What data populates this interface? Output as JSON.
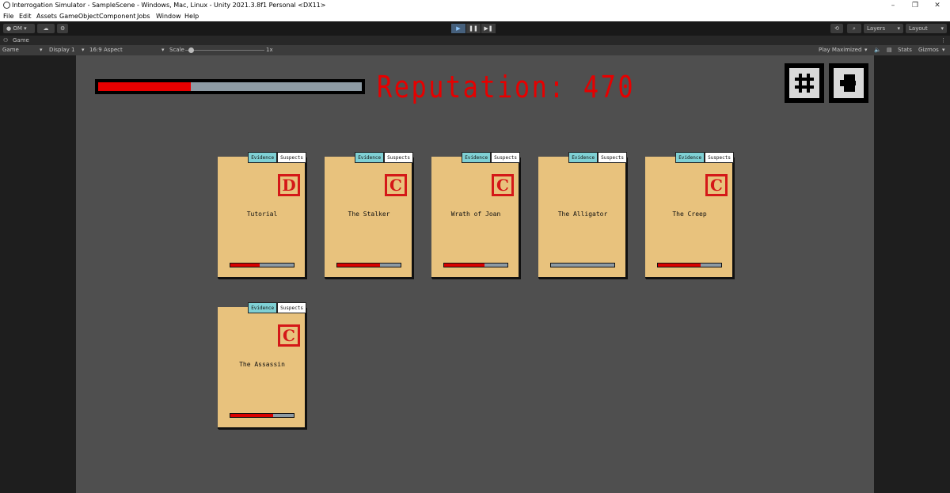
{
  "window": {
    "title": "Interrogation Simulator - SampleScene - Windows, Mac, Linux - Unity 2021.3.8f1 Personal <DX11>",
    "minimize": "–",
    "restore": "❐",
    "close": "✕"
  },
  "menu": [
    "File",
    "Edit",
    "Assets",
    "GameObject",
    "Component",
    "Jobs",
    "Window",
    "Help"
  ],
  "toolbar": {
    "account": "OM ▾",
    "layers": "Layers",
    "layout": "Layout",
    "play": "▶",
    "pause": "❚❚",
    "step": "▶❚"
  },
  "game_tab": {
    "label": "Game",
    "view_select": "Game",
    "display": "Display 1",
    "aspect": "16:9 Aspect",
    "scale_label": "Scale",
    "scale_value": "1x",
    "play_mode": "Play Maximized",
    "stats": "Stats",
    "gizmos": "Gizmos"
  },
  "hud": {
    "reputation_text": "Reputation: 470",
    "reputation_fraction": 0.35,
    "grid_button_icon": "hash-icon",
    "exit_button_icon": "door-exit-icon"
  },
  "colors": {
    "accent_red": "#e60000",
    "card_tan": "#e8c27d",
    "evidence_tab": "#7fd0d4"
  },
  "cases": [
    {
      "name": "Tutorial",
      "grade": "D",
      "progress": 0.46,
      "evidence_tab": "Evidence",
      "suspects_tab": "Suspects"
    },
    {
      "name": "The Stalker",
      "grade": "C",
      "progress": 0.67,
      "evidence_tab": "Evidence",
      "suspects_tab": "Suspects"
    },
    {
      "name": "Wrath of Joan",
      "grade": "C",
      "progress": 0.64,
      "evidence_tab": "Evidence",
      "suspects_tab": "Suspects"
    },
    {
      "name": "The Alligator",
      "grade": "",
      "progress": 0.0,
      "evidence_tab": "Evidence",
      "suspects_tab": "Suspects"
    },
    {
      "name": "The Creep",
      "grade": "C",
      "progress": 0.67,
      "evidence_tab": "Evidence",
      "suspects_tab": "Suspects"
    },
    {
      "name": "The Assassin",
      "grade": "C",
      "progress": 0.67,
      "evidence_tab": "Evidence",
      "suspects_tab": "Suspects"
    }
  ]
}
